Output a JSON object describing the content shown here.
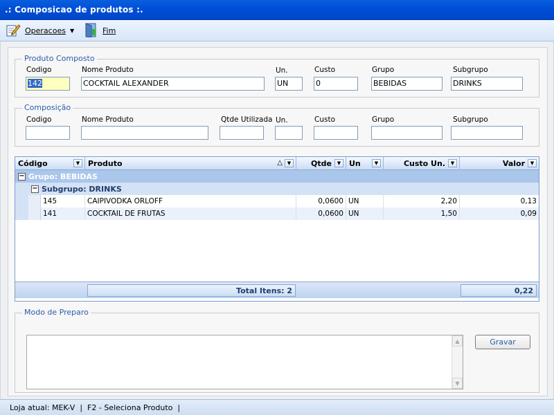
{
  "window": {
    "title": ".: Composicao de produtos :."
  },
  "toolbar": {
    "operacoes_label": "Operacoes",
    "fim_label": "Fim"
  },
  "produto_composto": {
    "legend": "Produto Composto",
    "labels": {
      "codigo": "Codigo",
      "nome": "Nome Produto",
      "un": "Un.",
      "custo": "Custo",
      "grupo": "Grupo",
      "subgrupo": "Subgrupo"
    },
    "values": {
      "codigo": "142",
      "nome": "COCKTAIL ALEXANDER",
      "un": "UN",
      "custo": "0",
      "grupo": "BEBIDAS",
      "subgrupo": "DRINKS"
    }
  },
  "composicao": {
    "legend": "Composição",
    "labels": {
      "codigo": "Codigo",
      "nome": "Nome Produto",
      "qtde": "Qtde Utilizada",
      "un": "Un.",
      "custo": "Custo",
      "grupo": "Grupo",
      "subgrupo": "Subgrupo"
    },
    "values": {
      "codigo": "",
      "nome": "",
      "qtde": "",
      "un": "",
      "custo": "",
      "grupo": "",
      "subgrupo": ""
    }
  },
  "grid": {
    "columns": [
      "Código",
      "Produto",
      "Qtde",
      "Un",
      "Custo Un.",
      "Valor"
    ],
    "sort_indicator": "△",
    "group_label": "Grupo: BEBIDAS",
    "subgroup_label": "Subgrupo: DRINKS",
    "rows": [
      {
        "codigo": "145",
        "produto": "CAIPIVODKA ORLOFF",
        "qtde": "0,0600",
        "un": "UN",
        "custo": "2,20",
        "valor": "0,13"
      },
      {
        "codigo": "141",
        "produto": "COCKTAIL DE FRUTAS",
        "qtde": "0,0600",
        "un": "UN",
        "custo": "1,50",
        "valor": "0,09"
      }
    ],
    "footer": {
      "total_itens": "Total Itens: 2",
      "total_valor": "0,22"
    }
  },
  "modo_preparo": {
    "legend": "Modo de Preparo",
    "text": "",
    "gravar_label": "Gravar"
  },
  "status": {
    "text": "Loja atual: MEK-V  |  F2 - Seleciona Produto  |"
  }
}
